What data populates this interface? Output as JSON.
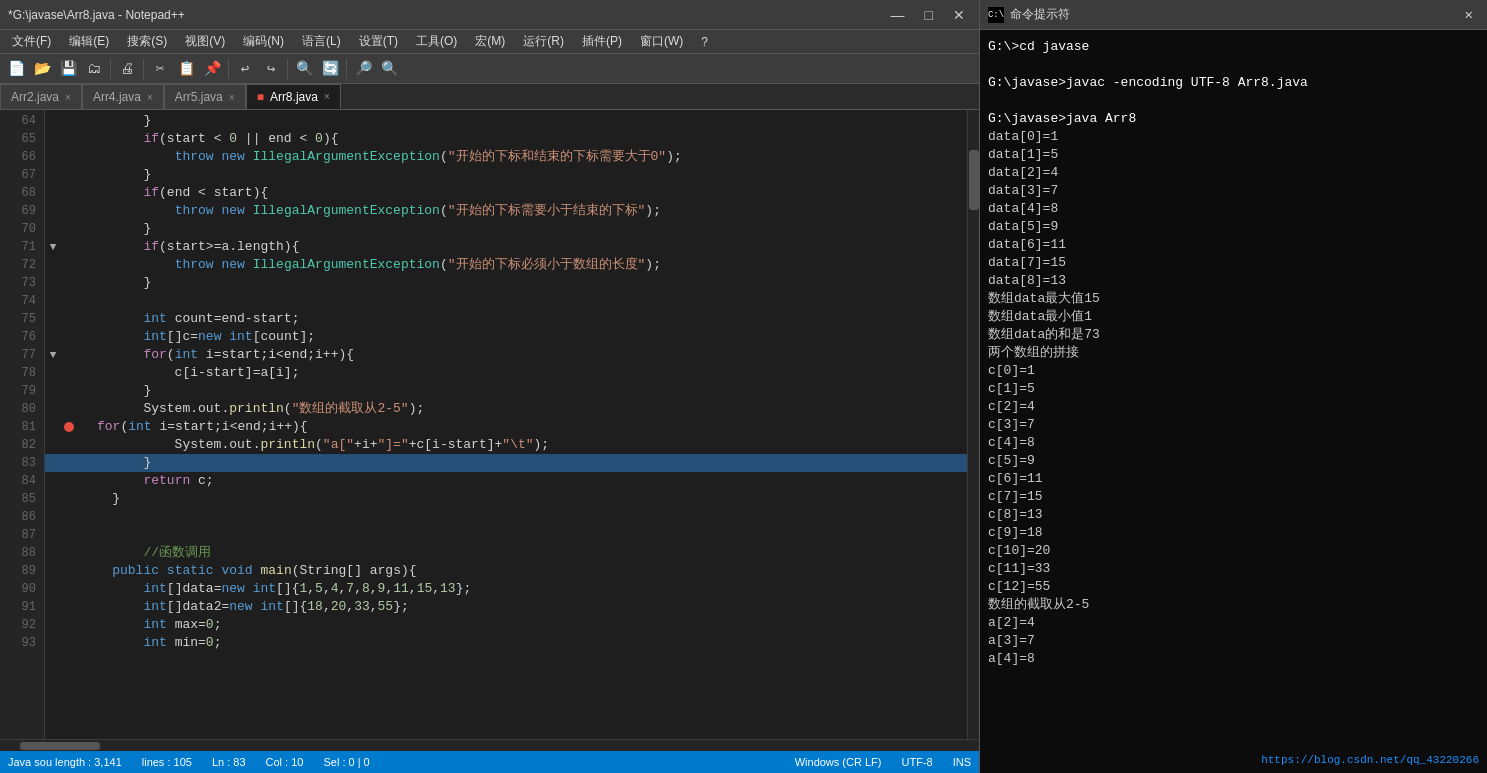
{
  "title_bar": {
    "text": "*G:\\javase\\Arr8.java - Notepad++",
    "minimize": "—",
    "maximize": "□",
    "close": "✕"
  },
  "menu": {
    "items": [
      "文件(F)",
      "编辑(E)",
      "搜索(S)",
      "视图(V)",
      "编码(N)",
      "语言(L)",
      "设置(T)",
      "工具(O)",
      "宏(M)",
      "运行(R)",
      "插件(P)",
      "窗口(W)",
      "?"
    ]
  },
  "tabs": [
    {
      "label": "Arr2.java",
      "active": false
    },
    {
      "label": "Arr4.java",
      "active": false
    },
    {
      "label": "Arr5.java",
      "active": false
    },
    {
      "label": "Arr8.java",
      "active": true
    }
  ],
  "code": {
    "lines": [
      {
        "num": 64,
        "text": "        }",
        "fold": false,
        "bp": false,
        "selected": false
      },
      {
        "num": 65,
        "text": "        if(start < 0 || end < 0){",
        "fold": false,
        "bp": false,
        "selected": false
      },
      {
        "num": 66,
        "text": "            throw new IllegalArgumentException(\"开始的下标和结束的下标需要大于0\");",
        "fold": false,
        "bp": false,
        "selected": false
      },
      {
        "num": 67,
        "text": "        }",
        "fold": false,
        "bp": false,
        "selected": false
      },
      {
        "num": 68,
        "text": "        if(end < start){",
        "fold": false,
        "bp": false,
        "selected": false
      },
      {
        "num": 69,
        "text": "            throw new IllegalArgumentException(\"开始的下标需要小于结束的下标\");",
        "fold": false,
        "bp": false,
        "selected": false
      },
      {
        "num": 70,
        "text": "        }",
        "fold": false,
        "bp": false,
        "selected": false
      },
      {
        "num": 71,
        "text": "        if(start>=a.length){",
        "fold": true,
        "bp": false,
        "selected": false
      },
      {
        "num": 72,
        "text": "            throw new IllegalArgumentException(\"开始的下标必须小于数组的长度\");",
        "fold": false,
        "bp": false,
        "selected": false
      },
      {
        "num": 73,
        "text": "        }",
        "fold": false,
        "bp": false,
        "selected": false
      },
      {
        "num": 74,
        "text": "",
        "fold": false,
        "bp": false,
        "selected": false
      },
      {
        "num": 75,
        "text": "        int count=end-start;",
        "fold": false,
        "bp": false,
        "selected": false
      },
      {
        "num": 76,
        "text": "        int[]c=new int[count];",
        "fold": false,
        "bp": false,
        "selected": false
      },
      {
        "num": 77,
        "text": "        for(int i=start;i<end;i++){",
        "fold": true,
        "bp": false,
        "selected": false
      },
      {
        "num": 78,
        "text": "            c[i-start]=a[i];",
        "fold": false,
        "bp": false,
        "selected": false
      },
      {
        "num": 79,
        "text": "        }",
        "fold": false,
        "bp": false,
        "selected": false
      },
      {
        "num": 80,
        "text": "        System.out.println(\"数组的截取从2-5\");",
        "fold": false,
        "bp": false,
        "selected": false
      },
      {
        "num": 81,
        "text": "        for(int i=start;i<end;i++){",
        "fold": false,
        "bp": true,
        "selected": false
      },
      {
        "num": 82,
        "text": "            System.out.println(\"a[\"+i+\"]=\"+c[i-start]+\"\\t\");",
        "fold": false,
        "bp": false,
        "selected": false
      },
      {
        "num": 83,
        "text": "        }",
        "fold": false,
        "bp": false,
        "selected": true
      },
      {
        "num": 84,
        "text": "        return c;",
        "fold": false,
        "bp": false,
        "selected": false
      },
      {
        "num": 85,
        "text": "    }",
        "fold": false,
        "bp": false,
        "selected": false
      },
      {
        "num": 86,
        "text": "",
        "fold": false,
        "bp": false,
        "selected": false
      },
      {
        "num": 87,
        "text": "",
        "fold": false,
        "bp": false,
        "selected": false
      },
      {
        "num": 88,
        "text": "        //函数调用",
        "fold": false,
        "bp": false,
        "selected": false
      },
      {
        "num": 89,
        "text": "    public static void main(String[] args){",
        "fold": false,
        "bp": false,
        "selected": false
      },
      {
        "num": 90,
        "text": "        int[]data=new int[]{1,5,4,7,8,9,11,15,13};",
        "fold": false,
        "bp": false,
        "selected": false
      },
      {
        "num": 91,
        "text": "        int[]data2=new int[]{18,20,33,55};",
        "fold": false,
        "bp": false,
        "selected": false
      },
      {
        "num": 92,
        "text": "        int max=0;",
        "fold": false,
        "bp": false,
        "selected": false
      },
      {
        "num": 93,
        "text": "        int min=0;",
        "fold": false,
        "bp": false,
        "selected": false
      }
    ]
  },
  "status_bar": {
    "length": "Java sou length : 3,141",
    "lines": "lines : 105",
    "ln": "Ln : 83",
    "col": "Col : 10",
    "sel": "Sel : 0 | 0",
    "eol": "Windows (CR LF)",
    "encoding": "UTF-8",
    "ins": "INS"
  },
  "cmd": {
    "title": "命令提示符",
    "lines": [
      "G:\\>cd javase",
      "",
      "G:\\javase>javac -encoding UTF-8 Arr8.java",
      "",
      "G:\\javase>java Arr8",
      "data[0]=1",
      "data[1]=5",
      "data[2]=4",
      "data[3]=7",
      "data[4]=8",
      "data[5]=9",
      "data[6]=11",
      "data[7]=15",
      "data[8]=13",
      "数组data最大值15",
      "数组data最小值1",
      "数组data的和是73",
      "两个数组的拼接",
      "c[0]=1",
      "c[1]=5",
      "c[2]=4",
      "c[3]=7",
      "c[4]=8",
      "c[5]=9",
      "c[6]=11",
      "c[7]=15",
      "c[8]=13",
      "c[9]=18",
      "c[10]=20",
      "c[11]=33",
      "c[12]=55",
      "数组的截取从2-5",
      "a[2]=4",
      "a[3]=7",
      "a[4]=8"
    ],
    "link": "https://blog.csdn.net/qq_43220266"
  }
}
